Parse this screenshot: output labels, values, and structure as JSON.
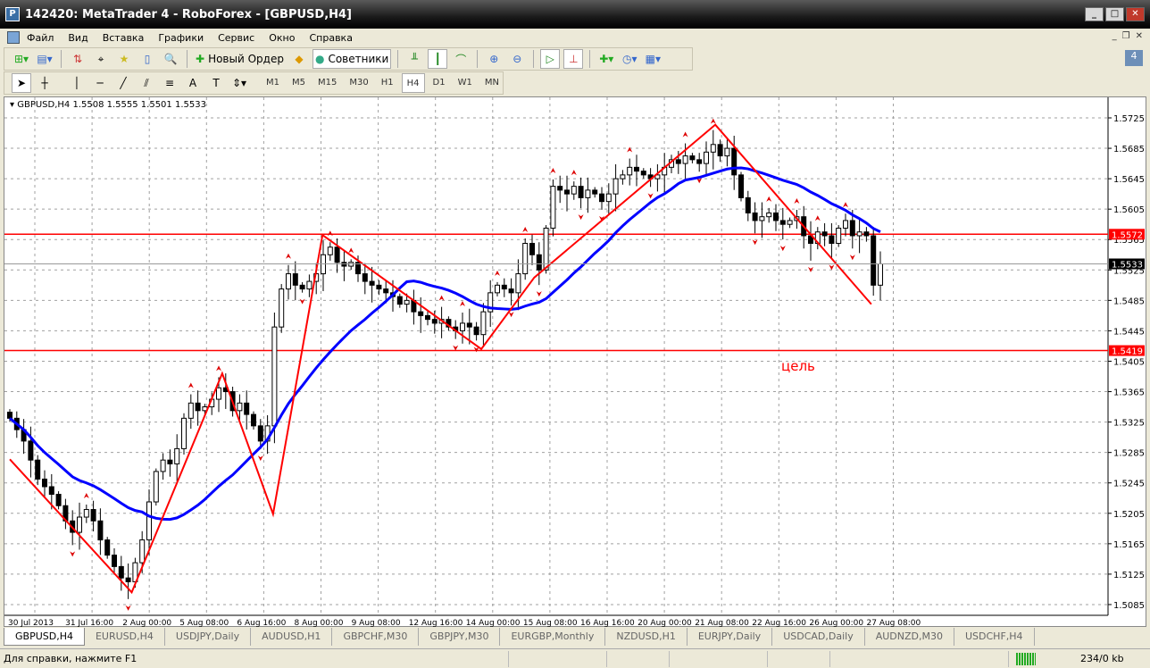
{
  "window": {
    "title": "142420: MetaTrader 4 - RoboForex - [GBPUSD,H4]"
  },
  "menu": [
    "Файл",
    "Вид",
    "Вставка",
    "Графики",
    "Сервис",
    "Окно",
    "Справка"
  ],
  "toolbar": {
    "new_order": "Новый Ордер",
    "experts": "Советники"
  },
  "timeframes": [
    "M1",
    "M5",
    "M15",
    "M30",
    "H1",
    "H4",
    "D1",
    "W1",
    "MN"
  ],
  "selected_timeframe": "H4",
  "chart": {
    "header": "GBPUSD,H4  1.5508 1.5555 1.5501 1.5533",
    "annotation": "цель",
    "colors": {
      "up": "#000000",
      "line": "#ff0000",
      "ma": "#0000ff",
      "bid": "#000000"
    }
  },
  "chart_data": {
    "type": "candlestick",
    "symbol": "GBPUSD",
    "timeframe": "H4",
    "ylim": [
      1.5075,
      1.576
    ],
    "yticks": [
      "1.5725",
      "1.5685",
      "1.5645",
      "1.5605",
      "1.5565",
      "1.5525",
      "1.5485",
      "1.5445",
      "1.5405",
      "1.5365",
      "1.5325",
      "1.5285",
      "1.5245",
      "1.5205",
      "1.5165",
      "1.5125",
      "1.5085"
    ],
    "xticks": [
      "30 Jul 2013",
      "31 Jul 16:00",
      "2 Aug 00:00",
      "5 Aug 08:00",
      "6 Aug 16:00",
      "8 Aug 00:00",
      "9 Aug 08:00",
      "12 Aug 16:00",
      "14 Aug 00:00",
      "15 Aug 08:00",
      "16 Aug 16:00",
      "20 Aug 00:00",
      "21 Aug 08:00",
      "22 Aug 16:00",
      "26 Aug 00:00",
      "27 Aug 08:00"
    ],
    "closes": [
      1.533,
      1.5315,
      1.53,
      1.5275,
      1.525,
      1.524,
      1.523,
      1.5215,
      1.5195,
      1.518,
      1.52,
      1.521,
      1.5195,
      1.517,
      1.515,
      1.5135,
      1.512,
      1.5115,
      1.514,
      1.517,
      1.522,
      1.526,
      1.5275,
      1.527,
      1.529,
      1.533,
      1.535,
      1.534,
      1.5345,
      1.5355,
      1.537,
      1.5365,
      1.534,
      1.535,
      1.5335,
      1.532,
      1.53,
      1.532,
      1.545,
      1.55,
      1.552,
      1.5505,
      1.55,
      1.551,
      1.552,
      1.5545,
      1.5555,
      1.5535,
      1.553,
      1.5535,
      1.552,
      1.551,
      1.5505,
      1.55,
      1.5495,
      1.549,
      1.548,
      1.5485,
      1.547,
      1.5465,
      1.546,
      1.5455,
      1.546,
      1.545,
      1.5445,
      1.5455,
      1.545,
      1.544,
      1.547,
      1.5495,
      1.5505,
      1.55,
      1.5495,
      1.552,
      1.556,
      1.5545,
      1.5525,
      1.558,
      1.5635,
      1.563,
      1.5625,
      1.5635,
      1.562,
      1.563,
      1.5625,
      1.5615,
      1.5625,
      1.5645,
      1.565,
      1.566,
      1.5655,
      1.565,
      1.5645,
      1.565,
      1.566,
      1.567,
      1.5665,
      1.5675,
      1.567,
      1.5665,
      1.568,
      1.569,
      1.5675,
      1.5685,
      1.565,
      1.562,
      1.56,
      1.559,
      1.5595,
      1.56,
      1.559,
      1.5585,
      1.559,
      1.5595,
      1.557,
      1.556,
      1.5575,
      1.557,
      1.556,
      1.558,
      1.559,
      1.557,
      1.5575,
      1.557,
      1.5505,
      1.5533
    ],
    "zigzag": [
      [
        0,
        1.5276
      ],
      [
        17.5,
        1.5101
      ],
      [
        30.5,
        1.5389
      ],
      [
        37.8,
        1.5204
      ],
      [
        44.9,
        1.5571
      ],
      [
        67.7,
        1.5421
      ],
      [
        75.3,
        1.5515
      ],
      [
        101.3,
        1.5716
      ],
      [
        123.7,
        1.548
      ]
    ],
    "hlines": [
      {
        "price": "1.5572"
      },
      {
        "price": "1.5419"
      }
    ],
    "bid": "1.5533",
    "ma_period": 20
  },
  "tabs": [
    "GBPUSD,H4",
    "EURUSD,H4",
    "USDJPY,Daily",
    "AUDUSD,H1",
    "GBPCHF,M30",
    "GBPJPY,M30",
    "EURGBP,Monthly",
    "NZDUSD,H1",
    "EURJPY,Daily",
    "USDCAD,Daily",
    "AUDNZD,M30",
    "USDCHF,H4"
  ],
  "status": {
    "help": "Для справки, нажмите F1",
    "traffic": "234/0 kb"
  }
}
